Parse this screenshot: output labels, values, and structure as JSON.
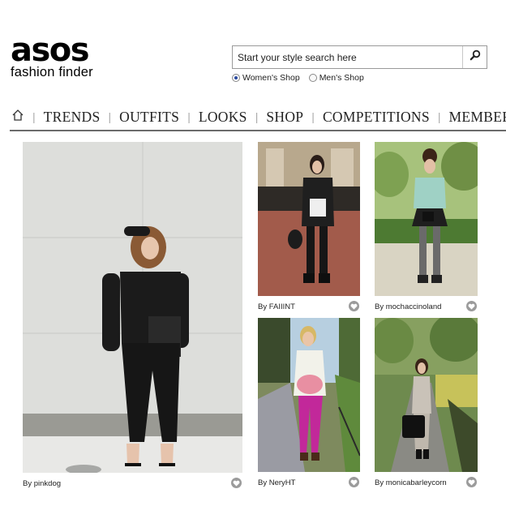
{
  "brand": {
    "wordmark": "asos",
    "subtitle": "fashion finder"
  },
  "search": {
    "placeholder": "Start your style search here",
    "value": "",
    "icon": "search-icon"
  },
  "shop_options": [
    {
      "label": "Women's Shop",
      "selected": true
    },
    {
      "label": "Men's Shop",
      "selected": false
    }
  ],
  "nav": {
    "home_icon": "home-icon",
    "separator": "|",
    "items": [
      "TRENDS",
      "OUTFITS",
      "LOOKS",
      "SHOP",
      "COMPETITIONS",
      "MEMBERS"
    ]
  },
  "looks": [
    {
      "by": "By",
      "user": "pinkdog",
      "icon": "love-heart-icon"
    },
    {
      "by": "By",
      "user": "FAIIINT",
      "icon": "love-heart-icon"
    },
    {
      "by": "By",
      "user": "mochaccinoland",
      "icon": "love-heart-icon"
    },
    {
      "by": "By",
      "user": "NeryHT",
      "icon": "love-heart-icon"
    },
    {
      "by": "By",
      "user": "monicabarleycorn",
      "icon": "love-heart-icon"
    }
  ],
  "colors": {
    "nav_rule": "#6b6b6b",
    "heart": "#9b9b9b",
    "radio_selected": "#2a4aa0"
  }
}
